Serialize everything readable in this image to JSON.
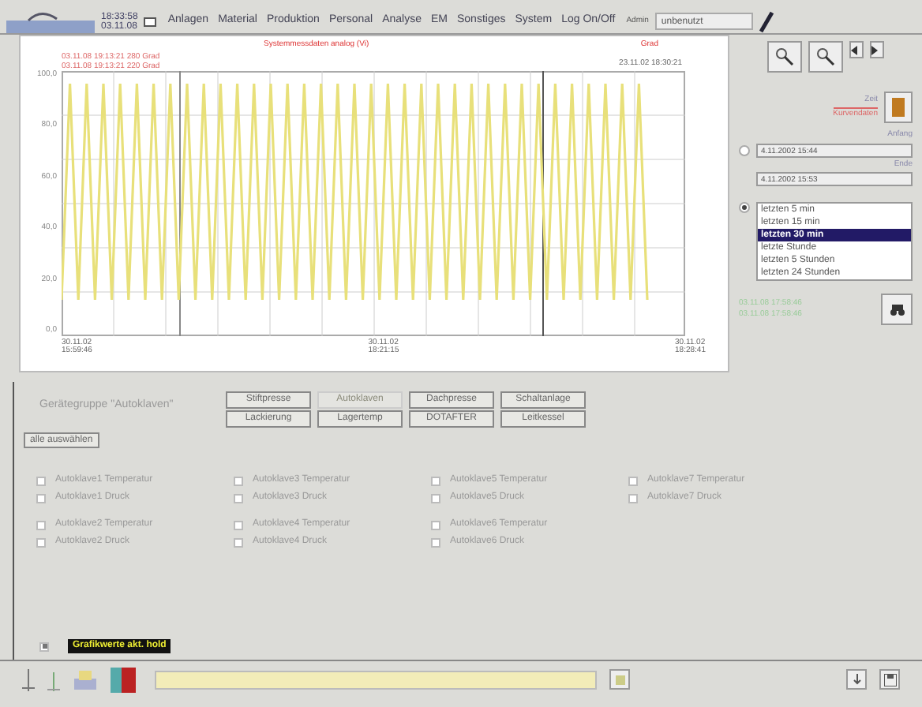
{
  "header": {
    "time": "18:33:58",
    "date": "03.11.08",
    "menu": [
      "Anlagen",
      "Material",
      "Produktion",
      "Personal",
      "Analyse",
      "EM",
      "Sonstiges",
      "System",
      "Log On/Off"
    ],
    "user_label": "Admin",
    "user_field": "unbenutzt"
  },
  "chart": {
    "title": "Systemmessdaten analog (Vi)",
    "unit": "Grad",
    "legend": [
      "03.11.08 19:13:21 280 Grad",
      "03.11.08 19:13:21 220 Grad"
    ],
    "cursor_label": "23.11.02 18:30:21",
    "y_labels": [
      "100,0",
      "80,0",
      "60,0",
      "40,0",
      "20,0",
      "0,0"
    ],
    "x_labels": [
      {
        "date": "30.11.02",
        "time": "15:59:46"
      },
      {
        "date": "30.11.02",
        "time": "18:21:15"
      },
      {
        "date": "30.11.02",
        "time": "18:28:41"
      }
    ]
  },
  "range": {
    "legend_top": "Zeit",
    "legend_bottom": "Kurvendaten",
    "radios": [
      {
        "selected": false
      },
      {
        "selected": true
      }
    ],
    "from_label": "Anfang",
    "from_value": "4.11.2002  15:44",
    "to_label": "Ende",
    "to_value": "4.11.2002  15:53",
    "list": [
      {
        "label": "letzten 5 min",
        "selected": false
      },
      {
        "label": "letzten 15 min",
        "selected": false
      },
      {
        "label": "letzten 30 min",
        "selected": true
      },
      {
        "label": "letzte Stunde",
        "selected": false
      },
      {
        "label": "letzten 5 Stunden",
        "selected": false
      },
      {
        "label": "letzten 24 Stunden",
        "selected": false
      }
    ],
    "stamps": [
      "03.11.08 17:58:46",
      "03.11.08 17:58:46"
    ]
  },
  "group": {
    "label": "Gerätegruppe \"Autoklaven\"",
    "buttons": [
      {
        "label": "Stiftpresse",
        "disabled": false
      },
      {
        "label": "Autoklaven",
        "disabled": true
      },
      {
        "label": "Dachpresse",
        "disabled": false
      },
      {
        "label": "Schaltanlage",
        "disabled": false
      },
      {
        "label": "Lackierung",
        "disabled": false
      },
      {
        "label": "Lagertemp",
        "disabled": false
      },
      {
        "label": "DOTAFTER",
        "disabled": false
      },
      {
        "label": "Leitkessel",
        "disabled": false
      }
    ],
    "select_all": "alle auswählen"
  },
  "signals": [
    [
      {
        "label": "Autoklave1 Temperatur",
        "checked": false
      },
      {
        "label": "Autoklave1 Druck",
        "checked": false
      }
    ],
    [
      {
        "label": "Autoklave3 Temperatur",
        "checked": false
      },
      {
        "label": "Autoklave3 Druck",
        "checked": false
      }
    ],
    [
      {
        "label": "Autoklave5 Temperatur",
        "checked": false
      },
      {
        "label": "Autoklave5 Druck",
        "checked": false
      }
    ],
    [
      {
        "label": "Autoklave7 Temperatur",
        "checked": false
      },
      {
        "label": "Autoklave7 Druck",
        "checked": false
      }
    ],
    [
      {
        "label": "Autoklave2 Temperatur",
        "checked": false
      },
      {
        "label": "Autoklave2 Druck",
        "checked": false
      }
    ],
    [
      {
        "label": "Autoklave4 Temperatur",
        "checked": false
      },
      {
        "label": "Autoklave4 Druck",
        "checked": false
      }
    ],
    [
      {
        "label": "Autoklave6 Temperatur",
        "checked": false
      },
      {
        "label": "Autoklave6 Druck",
        "checked": false
      }
    ]
  ],
  "footer": {
    "checked": true,
    "badge": "Grafikwerte akt. hold"
  }
}
